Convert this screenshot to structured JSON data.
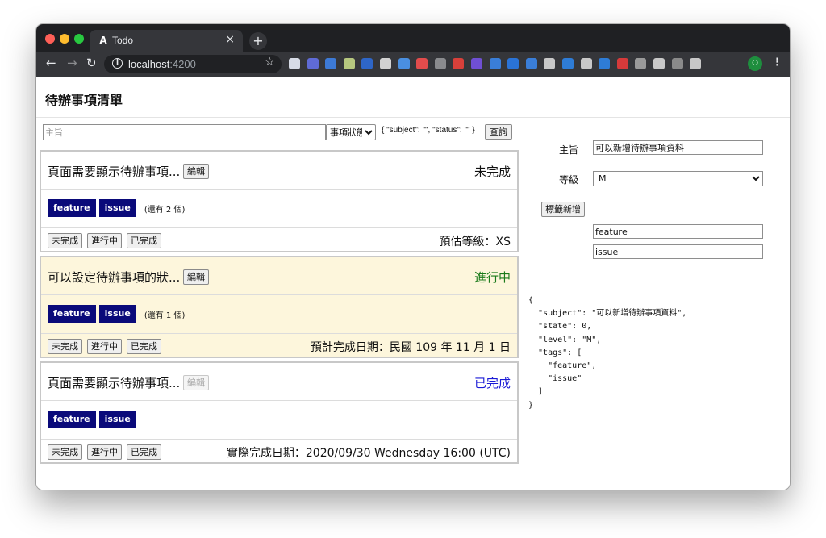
{
  "browser": {
    "tab_title": "Todo",
    "tab_icon": "A",
    "url_host": "localhost",
    "url_port": ":4200",
    "profile_initial": "O"
  },
  "page": {
    "title": "待辦事項清單",
    "search": {
      "subject_placeholder": "主旨",
      "status_selected": "事項狀態",
      "query_json": "{ \"subject\": \"\", \"status\": \"\" }",
      "query_button": "查詢"
    },
    "todos": [
      {
        "subject": "頁面需要顯示待辦事項...",
        "edit_label": "編輯",
        "status_text": "未完成",
        "status_color": "#111111",
        "tags": [
          "feature",
          "issue"
        ],
        "more_text": "(還有 2 個)",
        "buttons": [
          "未完成",
          "進行中",
          "已完成"
        ],
        "footer_text": "預估等級：XS"
      },
      {
        "subject": "可以設定待辦事項的狀...",
        "edit_label": "編輯",
        "status_text": "進行中",
        "status_color": "#1a7a1a",
        "tags": [
          "feature",
          "issue"
        ],
        "more_text": "(還有 1 個)",
        "buttons": [
          "未完成",
          "進行中",
          "已完成"
        ],
        "footer_text": "預計完成日期：民國 109 年 11 月 1 日"
      },
      {
        "subject": "頁面需要顯示待辦事項...",
        "edit_label": "編輯",
        "status_text": "已完成",
        "status_color": "#1a1ad6",
        "tags": [
          "feature",
          "issue"
        ],
        "more_text": "",
        "buttons": [
          "未完成",
          "進行中",
          "已完成"
        ],
        "footer_text": "實際完成日期：2020/09/30 Wednesday 16:00 (UTC)"
      }
    ],
    "form": {
      "subject_label": "主旨",
      "subject_value": "可以新增待辦事項資料",
      "level_label": "等級",
      "level_value": "M",
      "add_tag_button": "標籤新增",
      "tag_values": [
        "feature",
        "issue"
      ]
    },
    "json_output": "{\n  \"subject\": \"可以新增待辦事項資料\",\n  \"state\": 0,\n  \"level\": \"M\",\n  \"tags\": [\n    \"feature\",\n    \"issue\"\n  ]\n}"
  },
  "extension_icons": [
    "gem-icon",
    "onenote-icon",
    "compass-icon",
    "leaf-icon",
    "new-badge-icon",
    "kanji-icon",
    "card-icon",
    "block-icon",
    "bracket-icon",
    "calendar-icon",
    "figure-icon",
    "screen-icon",
    "blue-icon",
    "cloud-icon",
    "ghost-icon",
    "trello-icon",
    "bars-icon",
    "trello-icon-2",
    "abp-icon",
    "box-icon",
    "check-icon",
    "phone-icon",
    "puzzle-icon"
  ]
}
